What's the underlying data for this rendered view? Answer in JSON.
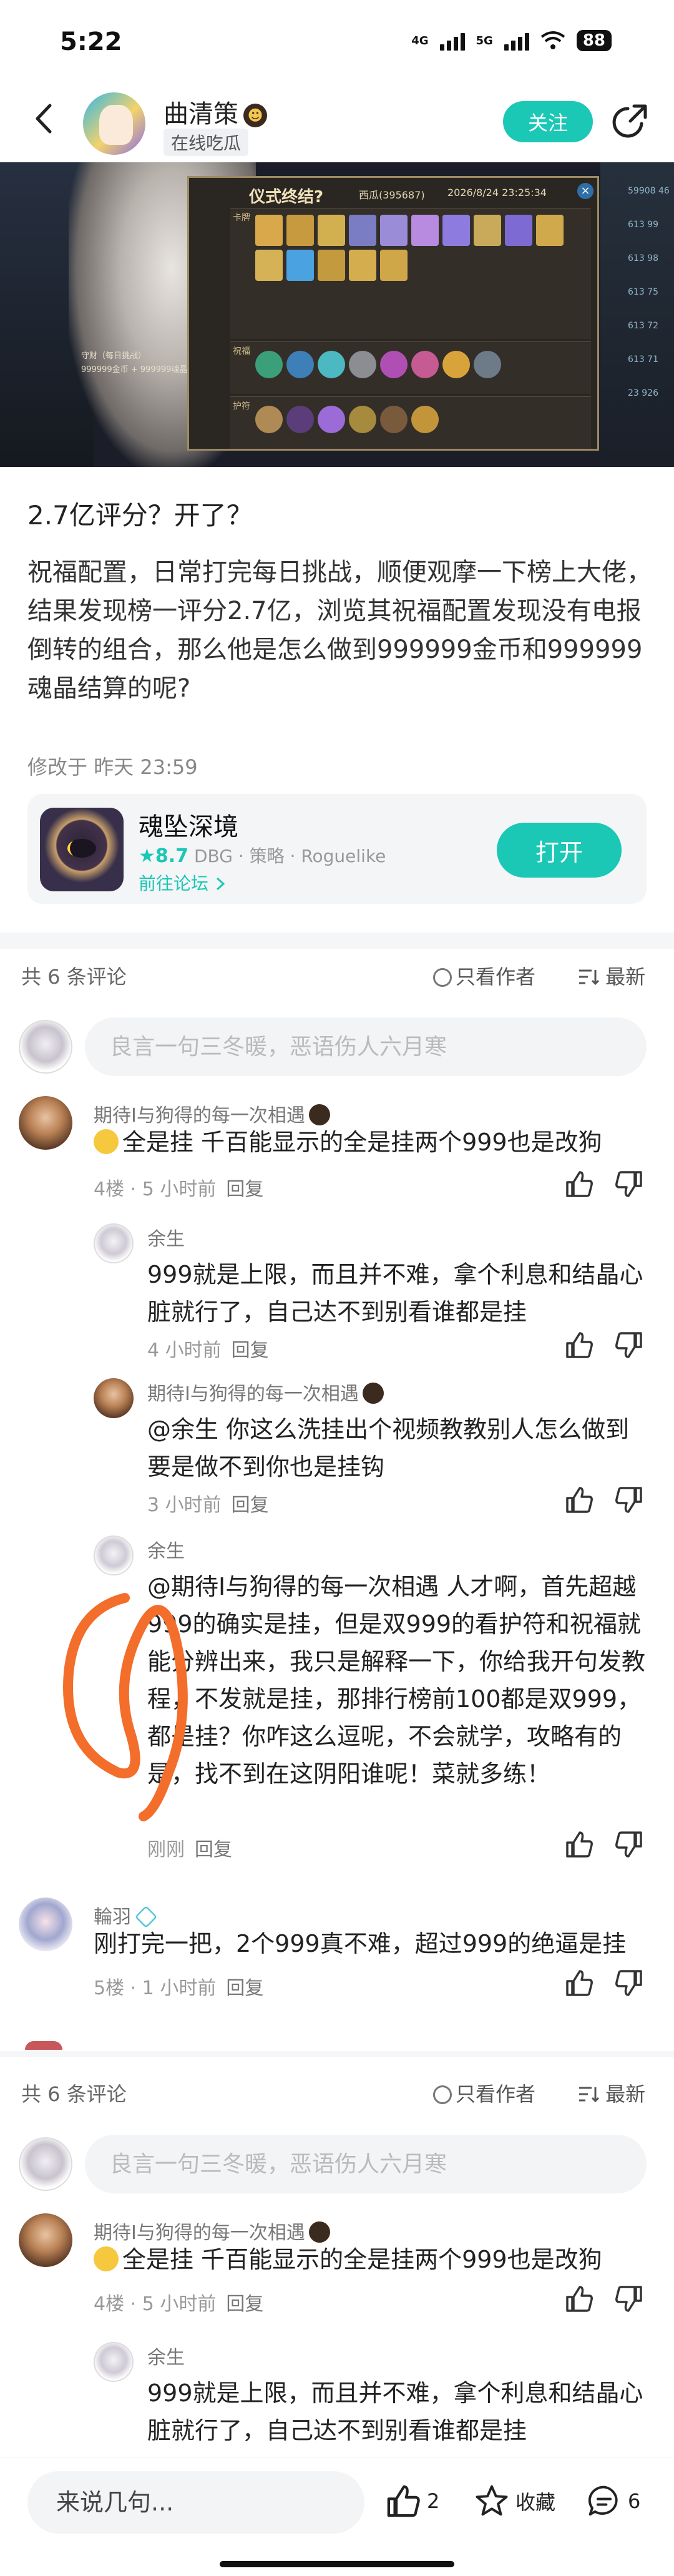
{
  "status_bar": {
    "time": "5:22",
    "net1": "4G",
    "net2": "5G",
    "battery": "88"
  },
  "header": {
    "author": "曲清策",
    "status": "在线吃瓜",
    "follow": "关注"
  },
  "cover": {
    "panel_title": "仪式终结?",
    "uid": "西瓜(395687)",
    "date": "2026/8/24 23:25:34",
    "rows": [
      "卡牌",
      "祝福",
      "护符"
    ],
    "side_text": [
      "守财（每日挑战）",
      "999999金币 + 999999魂晶"
    ]
  },
  "post": {
    "title": "2.7亿评分？开了？",
    "body": "祝福配置，日常打完每日挑战，顺便观摩一下榜上大佬，结果发现榜一评分2.7亿，浏览其祝福配置发现没有电报倒转的组合，那么他是怎么做到999999金币和999999魂晶结算的呢?",
    "edited": "修改于 昨天 23:59"
  },
  "game_card": {
    "name": "魂坠深境",
    "rating": "★8.7",
    "tags": "DBG · 策略 · Roguelike",
    "forum_link": "前往论坛",
    "open": "打开"
  },
  "comments_header": {
    "count": "共 6 条评论",
    "author_only": "只看作者",
    "sort": "最新"
  },
  "comment_input": {
    "placeholder": "良言一句三冬暖，恶语伤人六月寒"
  },
  "comments": [
    {
      "name": "期待I与狗得的每一次相遇",
      "text": "全是挂   千百能显示的全是挂两个999也是改狗",
      "floor": "4楼 · 5 小时前",
      "reply": "回复"
    },
    {
      "name": "余生",
      "text": "999就是上限，而且并不难，拿个利息和结晶心脏就行了，自己达不到别看谁都是挂",
      "time": "4 小时前",
      "reply": "回复"
    },
    {
      "name": "期待I与狗得的每一次相遇",
      "text": "@余生  你这么洗挂出个视频教教别人怎么做到   要是做不到你也是挂钩",
      "time": "3 小时前",
      "reply": "回复"
    },
    {
      "name": "余生",
      "text": "@期待I与狗得的每一次相遇  人才啊，首先超越999的确实是挂，但是双999的看护符和祝福就能分辨出来，我只是解释一下，你给我开句发教程，不发就是挂，那排行榜前100都是双999，都是挂？你咋这么逗呢，不会就学，攻略有的是，找不到在这阴阳谁呢！菜就多练！",
      "time": "刚刚",
      "reply": "回复"
    },
    {
      "name": "輪羽",
      "text": "刚打完一把，2个999真不难，超过999的绝逼是挂",
      "floor": "5楼 · 1 小时前",
      "reply": "回复"
    }
  ],
  "comments_repeat": [
    {
      "name": "期待I与狗得的每一次相遇",
      "text": "全是挂   千百能显示的全是挂两个999也是改狗",
      "floor": "4楼 · 5 小时前",
      "reply": "回复"
    },
    {
      "name": "余生",
      "text": "999就是上限，而且并不难，拿个利息和结晶心脏就行了，自己达不到别看谁都是挂"
    }
  ],
  "bottom_bar": {
    "placeholder": "来说几句...",
    "likes": "2",
    "favorite": "收藏",
    "comments": "6"
  },
  "colors": {
    "accent": "#1bc7b5",
    "annotation": "#f36d2b"
  }
}
